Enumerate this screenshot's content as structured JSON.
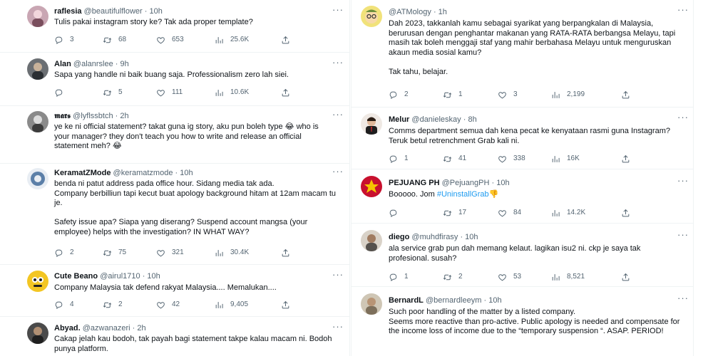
{
  "left": [
    {
      "name": "raflesia",
      "handle": "@beautifulflower",
      "time": "10h",
      "text": "Tulis pakai instagram story ke? Tak ada proper template?",
      "replies": "3",
      "retweets": "68",
      "likes": "653",
      "views": "25.6K"
    },
    {
      "name": "Alan",
      "handle": "@alanrslee",
      "time": "9h",
      "text": "Sapa yang handle ni baik buang saja. Professionalism zero lah siei.",
      "replies": "",
      "retweets": "5",
      "likes": "111",
      "views": "10.6K"
    },
    {
      "name": "𝖒𝖆𝖗𝖘",
      "handle": "@lyflssbtch",
      "time": "2h",
      "text": "ye ke ni official statement? takat guna ig story, aku pun boleh type 😂 who is your manager? they don't teach you how to write and release an official statement meh? 😂",
      "replies": "",
      "retweets": "",
      "likes": "",
      "views": ""
    },
    {
      "name": "KeramatZMode",
      "handle": "@keramatzmode",
      "time": "10h",
      "text": "benda ni patut address pada office hour. Sidang media tak ada.\nCompany berbilliun tapi kecut buat apology background hitam at 12am macam tu je.\n\nSafety issue apa? Siapa yang diserang? Suspend account mangsa (your employee) helps with the investigation? IN WHAT WAY?",
      "replies": "2",
      "retweets": "75",
      "likes": "321",
      "views": "30.4K"
    },
    {
      "name": "Cute Beano",
      "handle": "@airul1710",
      "time": "10h",
      "text": "Company Malaysia tak defend rakyat Malaysia.... Memalukan....",
      "replies": "4",
      "retweets": "2",
      "likes": "42",
      "views": "9,405"
    },
    {
      "name": "Abyad.",
      "handle": "@azwanazeri",
      "time": "2h",
      "text": "Cakap jelah kau bodoh, tak payah bagi statement takpe kalau macam ni. Bodoh punya platform.",
      "replies": "",
      "retweets": "",
      "likes": "",
      "views": ""
    }
  ],
  "right": [
    {
      "name": "",
      "handle": "@ATMology",
      "time": "1h",
      "text": "Dah 2023, takkanlah kamu sebagai syarikat yang berpangkalan di Malaysia, berurusan dengan penghantar makanan yang RATA-RATA berbangsa Melayu, tapi masih tak boleh menggaji staf yang mahir berbahasa Melayu untuk menguruskan akaun media sosial kamu?\n\nTak tahu, belajar.",
      "replies": "2",
      "retweets": "1",
      "likes": "3",
      "views": "2,199"
    },
    {
      "name": "Melur",
      "handle": "@danieleskay",
      "time": "8h",
      "text": "Comms department semua dah kena pecat ke kenyataan rasmi guna Instagram? Teruk betul retrenchment Grab kali ni.",
      "replies": "1",
      "retweets": "41",
      "likes": "338",
      "views": "16K"
    },
    {
      "name": "PEJUANG PH",
      "handle": "@PejuangPH",
      "time": "10h",
      "text": "Booooo. Jom ",
      "hashtag": "#UninstallGrab",
      "emoji": "👎",
      "replies": "",
      "retweets": "17",
      "likes": "84",
      "views": "14.2K"
    },
    {
      "name": "diego",
      "handle": "@muhdfirasy",
      "time": "10h",
      "text": "ala service grab pun dah memang kelaut. lagikan isu2 ni. ckp je saya tak profesional. susah?",
      "replies": "1",
      "retweets": "2",
      "likes": "53",
      "views": "8,521"
    },
    {
      "name": "BernardL",
      "handle": "@bernardleeym",
      "time": "10h",
      "text": "Such poor handling of the matter by a listed company.\nSeems more reactive than pro-active. Public apology is needed and compensate for the income loss of income due to the “temporary suspension “. ASAP. PERIOD!",
      "replies": "",
      "retweets": "",
      "likes": "",
      "views": ""
    }
  ],
  "icons": {
    "reply": "reply-icon",
    "retweet": "retweet-icon",
    "like": "heart-icon",
    "views": "views-icon",
    "share": "share-icon",
    "more": "more-icon"
  },
  "colors": {
    "text": "#0f1419",
    "muted": "#536471",
    "link": "#1d9bf0",
    "border": "#eff3f4"
  }
}
